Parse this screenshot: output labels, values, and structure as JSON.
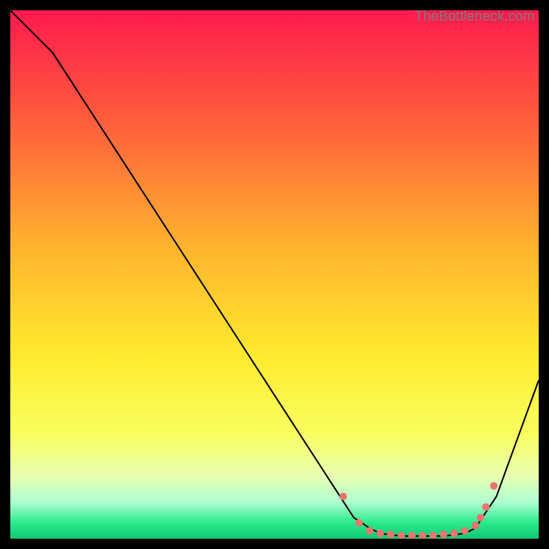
{
  "watermark": "TheBottleneck.com",
  "chart_data": {
    "type": "line",
    "title": "",
    "xlabel": "",
    "ylabel": "",
    "xlim": [
      0,
      100
    ],
    "ylim": [
      0,
      100
    ],
    "gradient_stops": [
      {
        "offset": 0,
        "color": "#ff1a4f"
      },
      {
        "offset": 20,
        "color": "#ff5a3c"
      },
      {
        "offset": 45,
        "color": "#ffb42e"
      },
      {
        "offset": 65,
        "color": "#ffe92e"
      },
      {
        "offset": 80,
        "color": "#f8ff5e"
      },
      {
        "offset": 88,
        "color": "#e9ffb0"
      },
      {
        "offset": 93,
        "color": "#b0ffd0"
      },
      {
        "offset": 97,
        "color": "#2bea8c"
      },
      {
        "offset": 100,
        "color": "#11c873"
      }
    ],
    "series": [
      {
        "name": "bottleneck-curve",
        "x": [
          0,
          4,
          8,
          65,
          68,
          70,
          74,
          78,
          82,
          86,
          88,
          92,
          100
        ],
        "y": [
          100,
          96,
          92,
          4,
          2,
          1,
          0.5,
          0.5,
          0.5,
          1,
          2,
          8,
          30
        ]
      }
    ],
    "markers": {
      "name": "highlight-dots",
      "color": "#e8766d",
      "x": [
        63,
        66,
        68,
        70,
        72,
        74,
        76,
        78,
        80,
        82,
        84,
        86,
        88,
        89,
        90,
        91.5
      ],
      "y": [
        8,
        3,
        1.5,
        1,
        0.8,
        0.6,
        0.6,
        0.6,
        0.6,
        0.8,
        1,
        1.5,
        2.5,
        4,
        6,
        10
      ]
    }
  }
}
